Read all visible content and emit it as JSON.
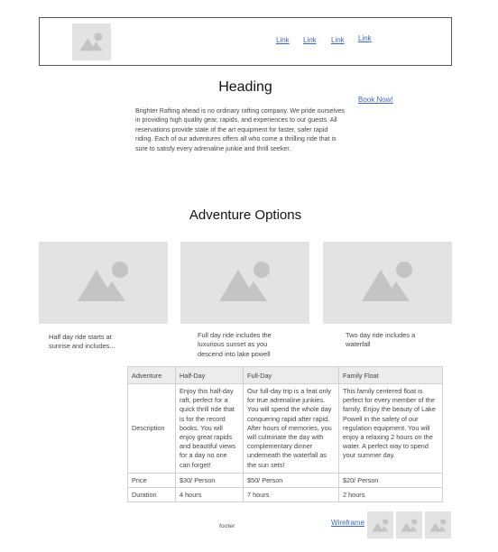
{
  "nav": {
    "logo_icon": "image-placeholder-icon",
    "links": [
      "Link",
      "Link",
      "Link",
      "Link"
    ]
  },
  "hero": {
    "heading": "Heading",
    "intro": "Brighter Rafting ahead is no ordinary rafting company. We pride ourselves in providing high quality gear, rapids, and experiences to our guests. All reservations provide state of the art equipment for faster, safer rapid riding. Each of our adventures offers all who come a thrilling ride that is sure to satisfy every adrenaline junkie and thrill seeker.",
    "book_now": "Book Now!"
  },
  "adventures": {
    "title": "Adventure Options",
    "cards": [
      {
        "image_icon": "image-placeholder-icon",
        "text": "Half day ride starts at sunrise and includes..."
      },
      {
        "image_icon": "image-placeholder-icon",
        "text": "Full day ride includes the luxurious sunset as you descend into lake powell"
      },
      {
        "image_icon": "image-placeholder-icon",
        "text": "Two day ride includes a waterfall"
      }
    ]
  },
  "table": {
    "headers": [
      "Adventure",
      "Half-Day",
      "Full-Day",
      "Family Float"
    ],
    "rows": [
      {
        "label": "Description",
        "cells": [
          "Enjoy this half-day raft, perfect for a quick thrill ride that is for the record books. You will enjoy great rapids and beautiful views for a day no one can forget!",
          "Our full-day trip is a feat only for true adrenaline junkies. You will spend the whole day conquering rapid after rapid. After hours of memories, you will culminate the day with complementary dinner underneath the waterfall as the sun sets!",
          "This family centered float is perfect for every member of the family. Enjoy the beauty of Lake Powell in the safety of our regulation equipment. You will enjoy a relaxing 2 hours on the water. A perfect way to spend your summer day."
        ]
      },
      {
        "label": "Price",
        "cells": [
          "$30/ Person",
          "$50/ Person",
          "$20/ Person"
        ]
      },
      {
        "label": "Duration",
        "cells": [
          "4 hours",
          "7 hours",
          "2 hours"
        ]
      }
    ]
  },
  "footer": {
    "text": "footer",
    "wireframe_link": "Wireframe",
    "thumb_icons": [
      "image-placeholder-icon",
      "image-placeholder-icon",
      "image-placeholder-icon"
    ]
  },
  "colors": {
    "link": "#3d67c4",
    "placeholder_bg": "#e3e3e3",
    "placeholder_shape": "#c4c4c4"
  }
}
